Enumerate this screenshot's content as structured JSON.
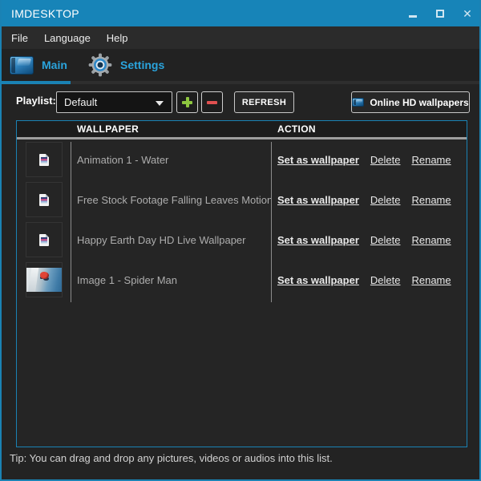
{
  "window": {
    "title": "IMDESKTOP"
  },
  "menu": {
    "items": [
      "File",
      "Language",
      "Help"
    ]
  },
  "tabs": {
    "main": "Main",
    "settings": "Settings"
  },
  "toolbar": {
    "playlist_label": "Playlist:",
    "playlist_value": "Default",
    "refresh": "REFRESH",
    "online": "Online HD wallpapers"
  },
  "table": {
    "columns": {
      "wallpaper": "WALLPAPER",
      "action": "ACTION"
    },
    "actions": {
      "set": "Set as wallpaper",
      "delete": "Delete",
      "rename": "Rename"
    },
    "rows": [
      {
        "name": "Animation 1 - Water",
        "thumb": "file-icon"
      },
      {
        "name": "Free Stock Footage Falling Leaves Motion Backg",
        "thumb": "file-icon"
      },
      {
        "name": "Happy Earth Day HD Live Wallpaper",
        "thumb": "file-icon"
      },
      {
        "name": "Image 1 - Spider Man",
        "thumb": "image-thumbnail"
      }
    ]
  },
  "tip": "Tip: You can drag and drop any pictures, videos or audios into this list.",
  "colors": {
    "titlebar": "#1784b8",
    "accent": "#2aa4dd",
    "table_border": "#1a82b4",
    "plus": "#8ec63f",
    "minus": "#e05050"
  }
}
